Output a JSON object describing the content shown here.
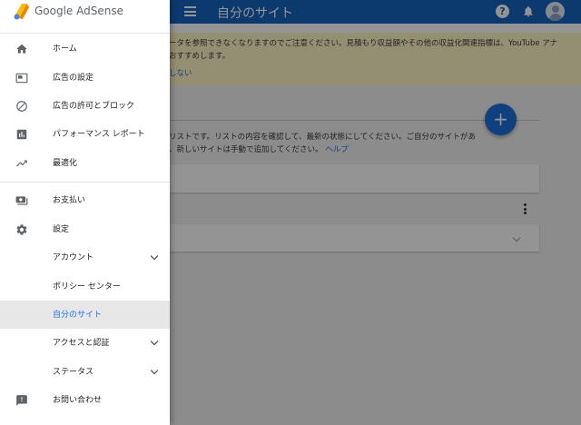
{
  "brand": {
    "name": "Google AdSense",
    "logo_icon": "adsense-logo-icon"
  },
  "topbar": {
    "title": "自分のサイト",
    "menu_icon": "menu-icon",
    "help_icon": "help-icon",
    "help_glyph": "?",
    "notifications_icon": "bell-icon",
    "account_icon": "account-avatar-icon",
    "color": "#1565c0"
  },
  "notice": {
    "line1": "ータを参照できなくなりますのでご注意ください。見積もり収益額やその他の収益化関連指標は、YouTube アナ",
    "line2": "おすすめします。",
    "link": "しない"
  },
  "main": {
    "add_label": "+",
    "description_line1": "リストです。リストの内容を確認して、最新の状態にしてください。ご自分のサイトがあ",
    "description_line2": "、新しいサイトは手動で追加してください。",
    "help_link": "ヘルプ"
  },
  "nav": {
    "items": [
      {
        "label": "ホーム",
        "icon": "home-icon"
      },
      {
        "label": "広告の設定",
        "icon": "ad-settings-icon"
      },
      {
        "label": "広告の許可とブロック",
        "icon": "block-icon"
      },
      {
        "label": "パフォーマンス レポート",
        "icon": "bar-chart-icon"
      },
      {
        "label": "最適化",
        "icon": "trending-up-icon"
      },
      {
        "label": "お支払い",
        "icon": "payments-icon"
      },
      {
        "label": "設定",
        "icon": "gear-icon"
      },
      {
        "label": "アカウント",
        "expandable": true
      },
      {
        "label": "ポリシー センター"
      },
      {
        "label": "自分のサイト",
        "active": true
      },
      {
        "label": "アクセスと認証",
        "expandable": true
      },
      {
        "label": "ステータス",
        "expandable": true
      },
      {
        "label": "お問い合わせ",
        "icon": "feedback-icon"
      }
    ]
  },
  "colors": {
    "accent": "#1a73e8",
    "notice_bg": "#fff6c4",
    "active_item_bg": "#e7e7e7"
  }
}
